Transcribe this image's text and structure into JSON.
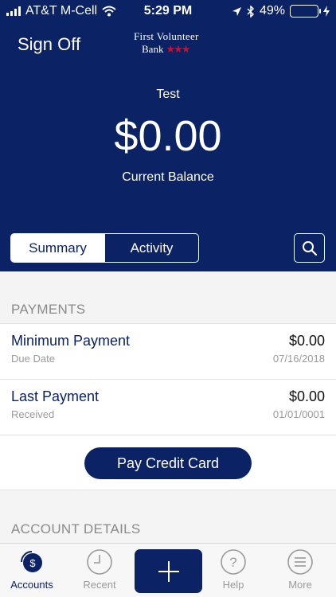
{
  "status": {
    "carrier": "AT&T M-Cell",
    "time": "5:29 PM",
    "battery": "49%",
    "battery_level": 0.49
  },
  "header": {
    "signoff_label": "Sign Off",
    "logo_line1": "First Volunteer",
    "logo_line2": "Bank"
  },
  "balance": {
    "account_name": "Test",
    "amount": "$0.00",
    "label": "Current Balance"
  },
  "tabs": [
    {
      "label": "Summary",
      "active": true
    },
    {
      "label": "Activity",
      "active": false
    }
  ],
  "payments": {
    "section_title": "PAYMENTS",
    "rows": [
      {
        "title": "Minimum Payment",
        "sub": "Due Date",
        "amount": "$0.00",
        "date": "07/16/2018"
      },
      {
        "title": "Last Payment",
        "sub": "Received",
        "amount": "$0.00",
        "date": "01/01/0001"
      }
    ],
    "pay_button": "Pay Credit Card"
  },
  "details": {
    "section_title": "ACCOUNT DETAILS"
  },
  "tabbar": {
    "accounts": "Accounts",
    "recent": "Recent",
    "help": "Help",
    "more": "More"
  },
  "colors": {
    "brand": "#0b2265",
    "accent_red": "#c8102e",
    "battery_green": "#4cd964"
  },
  "icons": [
    "signal-icon",
    "wifi-icon",
    "location-icon",
    "bluetooth-icon",
    "battery-icon",
    "charging-icon",
    "search-icon",
    "dollar-icon",
    "clock-icon",
    "plus-icon",
    "help-icon",
    "menu-icon"
  ]
}
